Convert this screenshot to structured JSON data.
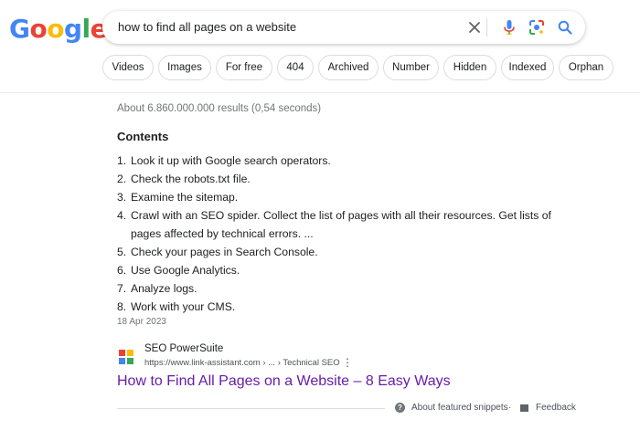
{
  "logo": {
    "letters": [
      "G",
      "o",
      "o",
      "g",
      "l",
      "e"
    ],
    "colors": [
      "#4285F4",
      "#EA4335",
      "#FBBC05",
      "#4285F4",
      "#34A853",
      "#EA4335"
    ]
  },
  "search": {
    "query": "how to find all pages on a website"
  },
  "icons": {
    "clear": "close-icon",
    "voice": "microphone-icon",
    "lens": "camera-lens-icon",
    "search": "search-icon"
  },
  "chips": [
    "Videos",
    "Images",
    "For free",
    "404",
    "Archived",
    "Number",
    "Hidden",
    "Indexed",
    "Orphan"
  ],
  "stats": "About 6.860.000.000 results (0,54 seconds)",
  "snippet": {
    "heading": "Contents",
    "items": [
      {
        "num": "1.",
        "text": "Look it up with Google search operators."
      },
      {
        "num": "2.",
        "text": "Check the robots.txt file."
      },
      {
        "num": "3.",
        "text": "Examine the sitemap."
      },
      {
        "num": "4.",
        "text": "Crawl with an SEO spider. Collect the list of pages with all their resources. Get lists of pages affected by technical errors. ..."
      },
      {
        "num": "5.",
        "text": "Check your pages in Search Console."
      },
      {
        "num": "6.",
        "text": "Use Google Analytics."
      },
      {
        "num": "7.",
        "text": "Analyze logs."
      },
      {
        "num": "8.",
        "text": "Work with your CMS."
      }
    ],
    "date": "18 Apr 2023"
  },
  "result": {
    "site_name": "SEO PowerSuite",
    "url": "https://www.link-assistant.com › ... › Technical SEO",
    "title": "How to Find All Pages on a Website – 8 Easy Ways"
  },
  "footer": {
    "about": "About featured snippets",
    "separator": "·",
    "feedback": "Feedback"
  },
  "colors": {
    "link_visited": "#681da8",
    "text": "#202124",
    "muted": "#70757a"
  }
}
